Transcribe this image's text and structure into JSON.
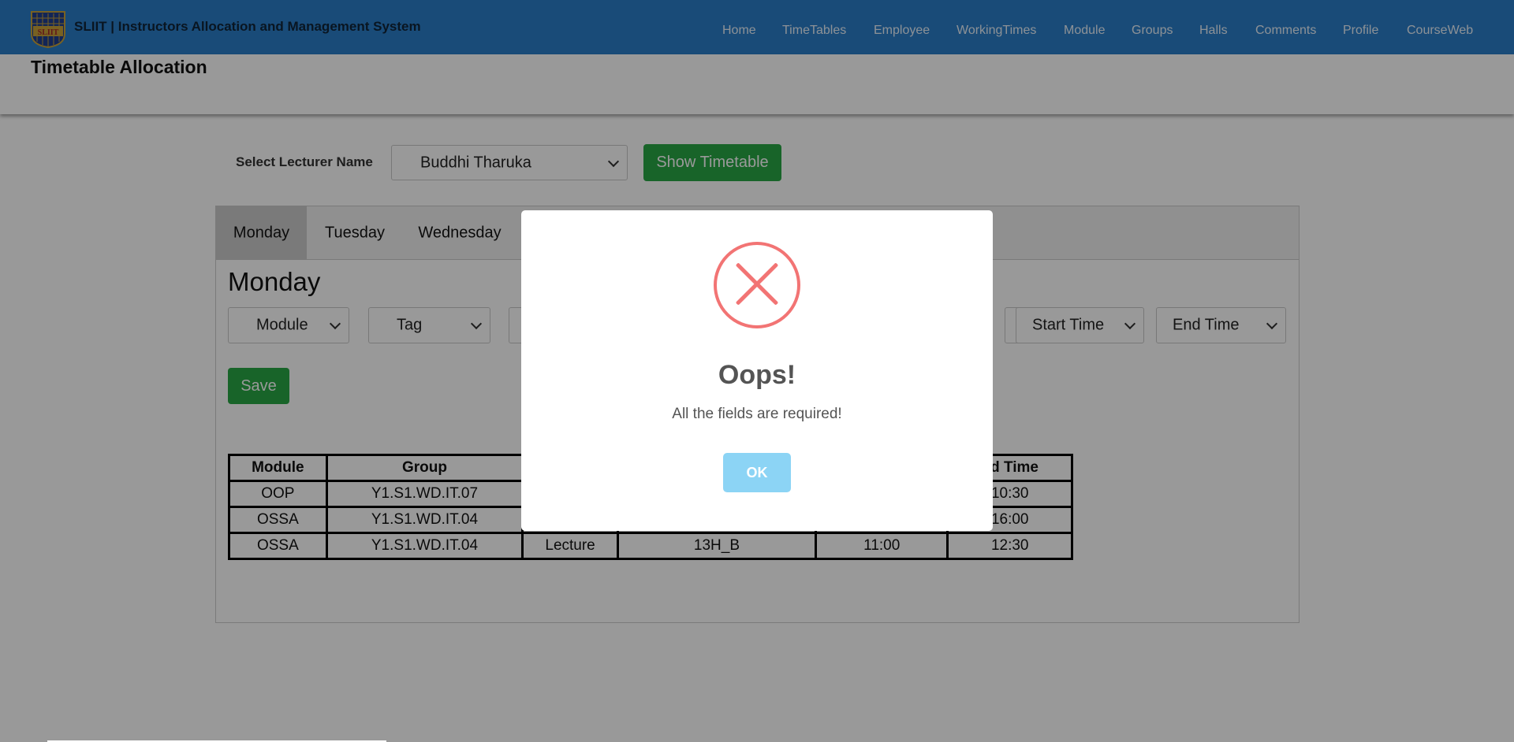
{
  "app": {
    "brand": "SLIIT | Instructors Allocation and Management System",
    "logo_text": "SLIIT"
  },
  "nav": {
    "items": [
      "Home",
      "TimeTables",
      "Employee",
      "WorkingTimes",
      "Module",
      "Groups",
      "Halls",
      "Comments",
      "Profile",
      "CourseWeb"
    ]
  },
  "page": {
    "title": "Timetable Allocation"
  },
  "lecturer": {
    "label": "Select Lecturer Name",
    "selected": "Buddhi Tharuka",
    "show_button": "Show Timetable"
  },
  "tabs": [
    "Monday",
    "Tuesday",
    "Wednesday"
  ],
  "day": {
    "title": "Monday",
    "selects": {
      "module": "Module",
      "tag": "Tag",
      "start_time": "Start Time",
      "end_time": "End Time"
    },
    "save_button": "Save"
  },
  "table": {
    "headers": [
      "Module",
      "Group",
      "",
      "",
      "",
      "nd Time"
    ],
    "rows": [
      [
        "OOP",
        "Y1.S1.WD.IT.07",
        "",
        "",
        "",
        "10:30"
      ],
      [
        "OSSA",
        "Y1.S1.WD.IT.04",
        "",
        "_",
        "",
        "16:00"
      ],
      [
        "OSSA",
        "Y1.S1.WD.IT.04",
        "Lecture",
        "13H_B",
        "11:00",
        "12:30"
      ]
    ]
  },
  "modal": {
    "icon": "error-x-icon",
    "title": "Oops!",
    "text": "All the fields are required!",
    "ok_button": "OK"
  },
  "colors": {
    "navbar": "#2a7ec9",
    "green": "#28a745",
    "error": "#f27474",
    "ok": "#8cd4f5"
  }
}
